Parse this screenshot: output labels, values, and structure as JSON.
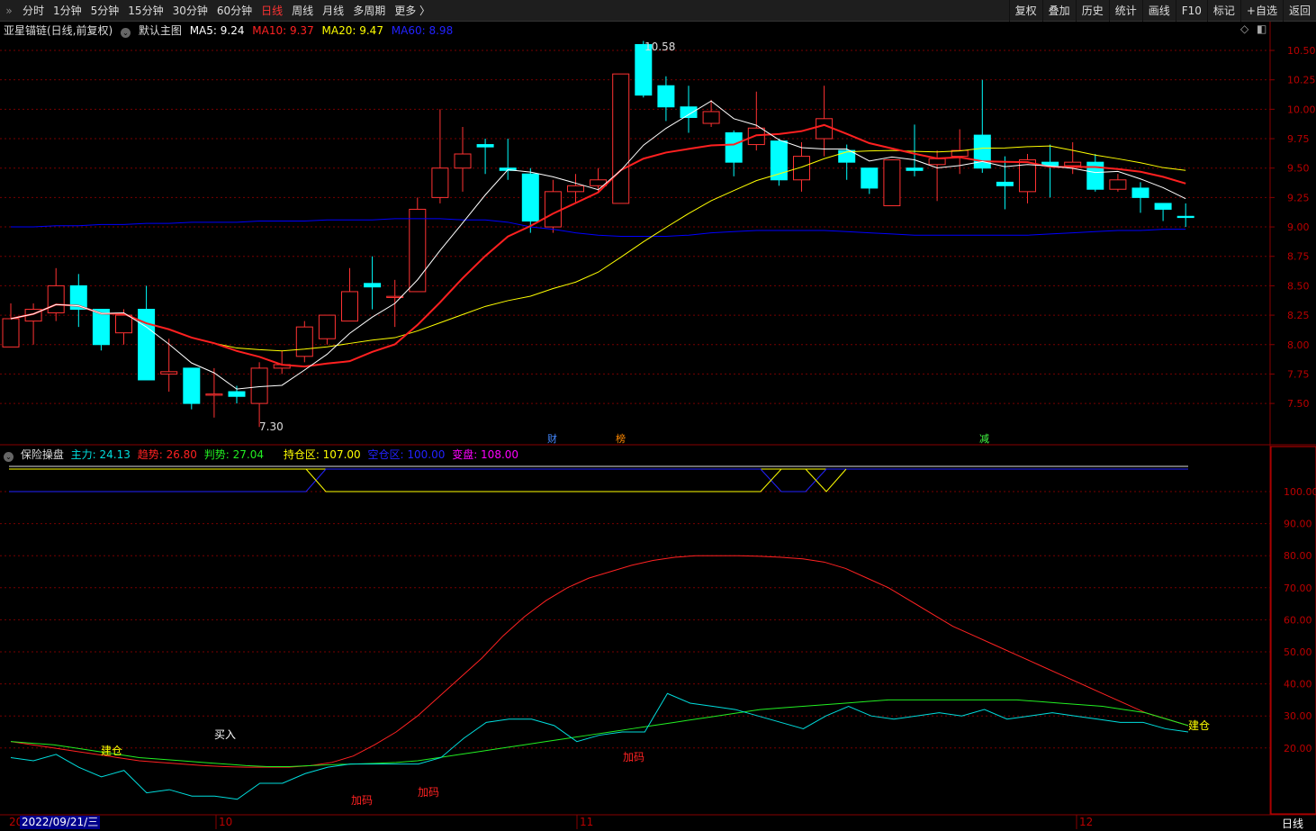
{
  "toolbar": {
    "tabs": [
      "分时",
      "1分钟",
      "5分钟",
      "15分钟",
      "30分钟",
      "60分钟",
      "日线",
      "周线",
      "月线",
      "多周期",
      "更多 〉"
    ],
    "active": "日线",
    "buttons": [
      "复权",
      "叠加",
      "历史",
      "统计",
      "画线",
      "F10",
      "标记",
      "+自选",
      "返回"
    ]
  },
  "main": {
    "title": "亚星锚链(日线,前复权)",
    "template": "默认主图",
    "ma5": "MA5: 9.24",
    "ma10": "MA10: 9.37",
    "ma20": "MA20: 9.47",
    "ma60": "MA60: 8.98",
    "high_label": "10.58",
    "low_label": "7.30",
    "markers": [
      "财",
      "榜",
      "减"
    ]
  },
  "sub": {
    "title": "保险操盘",
    "zl": "主力: 24.13",
    "qs": "趋势: 26.80",
    "ps": "判势: 27.04",
    "cc": "持仓区: 107.00",
    "kc": "空仓区: 100.00",
    "bp": "变盘: 108.00",
    "signals": [
      "建仓",
      "买入",
      "加码",
      "加码",
      "加码",
      "建仓"
    ]
  },
  "xaxis": {
    "date": "2022/09/21/三",
    "months": [
      "10",
      "11",
      "12"
    ],
    "period": "日线",
    "first": "20"
  },
  "colors": {
    "up": "#ff3232",
    "down": "#00ffff",
    "ma5": "#ffffff",
    "ma10": "#ff2020",
    "ma20": "#ffff00",
    "ma60": "#0000ff"
  },
  "chart_data": [
    {
      "type": "candlestick",
      "title": "亚星锚链(日线,前复权)",
      "ylim": [
        7.25,
        10.7
      ],
      "yticks": [
        "10.50",
        "10.25",
        "10.00",
        "9.75",
        "9.50",
        "9.25",
        "9.00",
        "8.75",
        "8.50",
        "8.25",
        "8.00",
        "7.75",
        "7.50"
      ],
      "ohlc": [
        [
          7.98,
          8.35,
          7.98,
          8.22
        ],
        [
          8.2,
          8.35,
          8.0,
          8.3
        ],
        [
          8.27,
          8.65,
          8.2,
          8.5
        ],
        [
          8.5,
          8.6,
          8.15,
          8.3
        ],
        [
          8.3,
          8.3,
          7.95,
          8.0
        ],
        [
          8.1,
          8.3,
          8.0,
          8.25
        ],
        [
          8.3,
          8.5,
          7.7,
          7.7
        ],
        [
          7.75,
          8.05,
          7.6,
          7.77
        ],
        [
          7.8,
          7.8,
          7.45,
          7.5
        ],
        [
          7.57,
          7.8,
          7.38,
          7.58
        ],
        [
          7.6,
          7.65,
          7.5,
          7.56
        ],
        [
          7.5,
          7.85,
          7.3,
          7.8
        ],
        [
          7.8,
          7.95,
          7.75,
          7.83
        ],
        [
          7.9,
          8.2,
          7.85,
          8.15
        ],
        [
          8.05,
          8.25,
          8.0,
          8.25
        ],
        [
          8.2,
          8.65,
          8.2,
          8.45
        ],
        [
          8.52,
          8.75,
          8.3,
          8.49
        ],
        [
          8.4,
          8.55,
          8.15,
          8.41
        ],
        [
          8.45,
          9.25,
          8.45,
          9.15
        ],
        [
          9.25,
          10.0,
          9.2,
          9.5
        ],
        [
          9.5,
          9.85,
          9.3,
          9.62
        ],
        [
          9.7,
          9.75,
          9.45,
          9.68
        ],
        [
          9.5,
          9.75,
          9.4,
          9.48
        ],
        [
          9.45,
          9.5,
          8.95,
          9.05
        ],
        [
          9.0,
          9.4,
          8.95,
          9.3
        ],
        [
          9.3,
          9.45,
          9.2,
          9.35
        ],
        [
          9.35,
          9.5,
          9.3,
          9.4
        ],
        [
          9.2,
          10.3,
          9.2,
          10.3
        ],
        [
          10.55,
          10.58,
          10.1,
          10.12
        ],
        [
          10.2,
          10.28,
          9.9,
          10.02
        ],
        [
          10.02,
          10.2,
          9.8,
          9.93
        ],
        [
          9.88,
          10.08,
          9.85,
          9.98
        ],
        [
          9.8,
          9.82,
          9.43,
          9.55
        ],
        [
          9.7,
          10.15,
          9.65,
          9.84
        ],
        [
          9.73,
          9.75,
          9.35,
          9.4
        ],
        [
          9.4,
          9.72,
          9.3,
          9.6
        ],
        [
          9.75,
          10.2,
          9.6,
          9.92
        ],
        [
          9.65,
          9.7,
          9.4,
          9.55
        ],
        [
          9.5,
          9.5,
          9.28,
          9.33
        ],
        [
          9.18,
          9.57,
          9.18,
          9.57
        ],
        [
          9.5,
          9.87,
          9.43,
          9.48
        ],
        [
          9.53,
          9.65,
          9.22,
          9.58
        ],
        [
          9.6,
          9.83,
          9.45,
          9.65
        ],
        [
          9.78,
          10.25,
          9.46,
          9.5
        ],
        [
          9.38,
          9.6,
          9.15,
          9.35
        ],
        [
          9.3,
          9.62,
          9.2,
          9.57
        ],
        [
          9.55,
          9.7,
          9.25,
          9.52
        ],
        [
          9.52,
          9.72,
          9.45,
          9.55
        ],
        [
          9.55,
          9.62,
          9.3,
          9.32
        ],
        [
          9.32,
          9.45,
          9.3,
          9.4
        ],
        [
          9.33,
          9.38,
          9.12,
          9.25
        ],
        [
          9.2,
          9.2,
          9.05,
          9.15
        ],
        [
          9.09,
          9.2,
          9.0,
          9.08
        ]
      ],
      "ma60": [
        9.0,
        9.0,
        9.01,
        9.01,
        9.02,
        9.02,
        9.03,
        9.03,
        9.04,
        9.04,
        9.04,
        9.05,
        9.05,
        9.05,
        9.06,
        9.06,
        9.06,
        9.07,
        9.07,
        9.07,
        9.06,
        9.06,
        9.04,
        9.0,
        8.98,
        8.95,
        8.93,
        8.92,
        8.92,
        8.92,
        8.93,
        8.95,
        8.96,
        8.97,
        8.97,
        8.97,
        8.97,
        8.96,
        8.95,
        8.94,
        8.93,
        8.93,
        8.93,
        8.93,
        8.93,
        8.93,
        8.94,
        8.95,
        8.96,
        8.97,
        8.97,
        8.98,
        8.98
      ]
    },
    {
      "type": "line",
      "title": "保险操盘",
      "ylim": [
        10,
        110
      ],
      "yticks": [
        "100.00",
        "90.00",
        "80.00",
        "70.00",
        "60.00",
        "50.00",
        "40.00",
        "30.00",
        "20.00"
      ],
      "series": [
        {
          "name": "趋势",
          "values": [
            22,
            21,
            20,
            19,
            18,
            17,
            16,
            15.5,
            15,
            14.5,
            14.2,
            14,
            14,
            14,
            14.5,
            15.5,
            17.5,
            21,
            25,
            30,
            36,
            42,
            48,
            55,
            61,
            66,
            70,
            73,
            75,
            77,
            78.5,
            79.5,
            80,
            80,
            80,
            79.8,
            79.5,
            79,
            78,
            76,
            73,
            70,
            66,
            62,
            58,
            55,
            52,
            49,
            46,
            43,
            40,
            37,
            34,
            31,
            29,
            27
          ]
        },
        {
          "name": "判势",
          "values": [
            22,
            21.5,
            21,
            20,
            19,
            18,
            17,
            16.5,
            16,
            15.5,
            15,
            14.5,
            14.2,
            14.2,
            14.5,
            14.8,
            15,
            15.2,
            15.5,
            16,
            17,
            18,
            19,
            20,
            21,
            22,
            23,
            24,
            25,
            26,
            27,
            28,
            29,
            30,
            31,
            32,
            32.5,
            33,
            33.5,
            34,
            34.5,
            35,
            35,
            35,
            35,
            35,
            35,
            35,
            34.5,
            34,
            33.5,
            33,
            32,
            31,
            29,
            27
          ]
        },
        {
          "name": "主力",
          "values": [
            17,
            16,
            18,
            14,
            11,
            13,
            6,
            7,
            5,
            5,
            4,
            9,
            9,
            12,
            14,
            15,
            15,
            15,
            15,
            17,
            23,
            28,
            29,
            29,
            27,
            22,
            24,
            25,
            25,
            37,
            34,
            33,
            32,
            30,
            28,
            26,
            30,
            33,
            30,
            29,
            30,
            31,
            30,
            32,
            29,
            30,
            31,
            30,
            29,
            28,
            28,
            26,
            25
          ]
        }
      ]
    }
  ]
}
